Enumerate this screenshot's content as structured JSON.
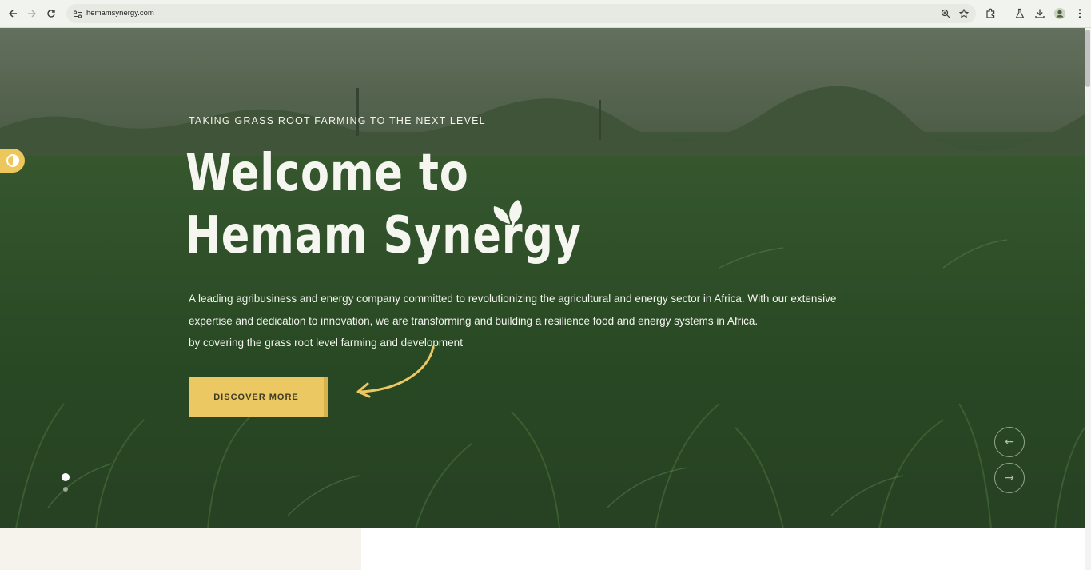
{
  "browser": {
    "url": "hemamsynergy.com",
    "icons": [
      "back-icon",
      "forward-icon",
      "reload-icon",
      "site-info-icon",
      "zoom-icon",
      "bookmark-star-icon",
      "extensions-icon",
      "labs-icon",
      "download-icon",
      "profile-icon",
      "menu-icon"
    ]
  },
  "hero": {
    "tagline": "TAKING GRASS ROOT FARMING TO THE NEXT LEVEL",
    "title_line1": "Welcome to",
    "title_line2": "Hemam Synergy",
    "description_line1": "A leading agribusiness and energy company committed to revolutionizing the agricultural and energy sector in Africa. With our extensive",
    "description_line2": "expertise and dedication to innovation, we are transforming and building a resilience food and energy systems in Africa.",
    "description_line3": "by covering the grass root level farming and development",
    "cta_label": "DISCOVER MORE",
    "prev_arrow": "←",
    "next_arrow": "→",
    "slides_total": 2,
    "slide_active": 1
  },
  "colors": {
    "accent": "#ecc862",
    "hero_text": "#f6f6f0",
    "hero_green": "#2f5129",
    "section_beige": "#f5f3ec"
  }
}
